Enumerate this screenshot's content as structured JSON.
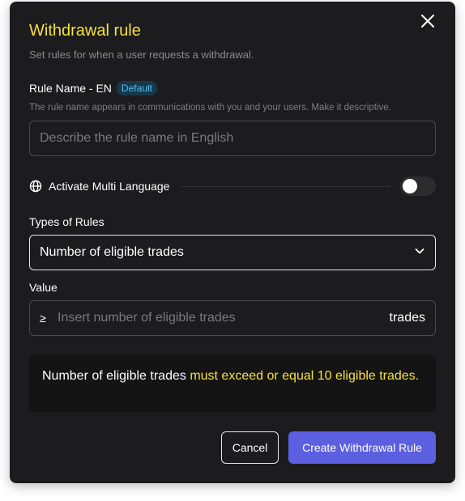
{
  "modal": {
    "title": "Withdrawal rule",
    "subtitle": "Set rules for when a user requests a withdrawal.",
    "close_icon": "close-icon"
  },
  "rule_name": {
    "label": "Rule Name - EN",
    "badge": "Default",
    "helper": "The rule name appears in communications with you and your users. Make it descriptive.",
    "placeholder": "Describe the rule name in English",
    "value": ""
  },
  "multi_language": {
    "label": "Activate Multi Language",
    "icon": "globe-icon",
    "enabled": false
  },
  "rule_type": {
    "label": "Types of Rules",
    "selected": "Number of eligible trades",
    "icon": "chevron-down-icon"
  },
  "value_field": {
    "label": "Value",
    "prefix": "≥",
    "placeholder": "Insert number of eligible trades",
    "unit": "trades"
  },
  "info": {
    "text_plain": "Number of eligible trades ",
    "text_highlight": "must exceed or equal 10 eligible trades",
    "text_end": "."
  },
  "buttons": {
    "cancel": "Cancel",
    "create": "Create Withdrawal Rule"
  },
  "colors": {
    "accent_yellow": "#f5e03b",
    "primary_button": "#5b5fe0",
    "badge_text": "#4cc3f0",
    "background": "#1c1c1e"
  }
}
